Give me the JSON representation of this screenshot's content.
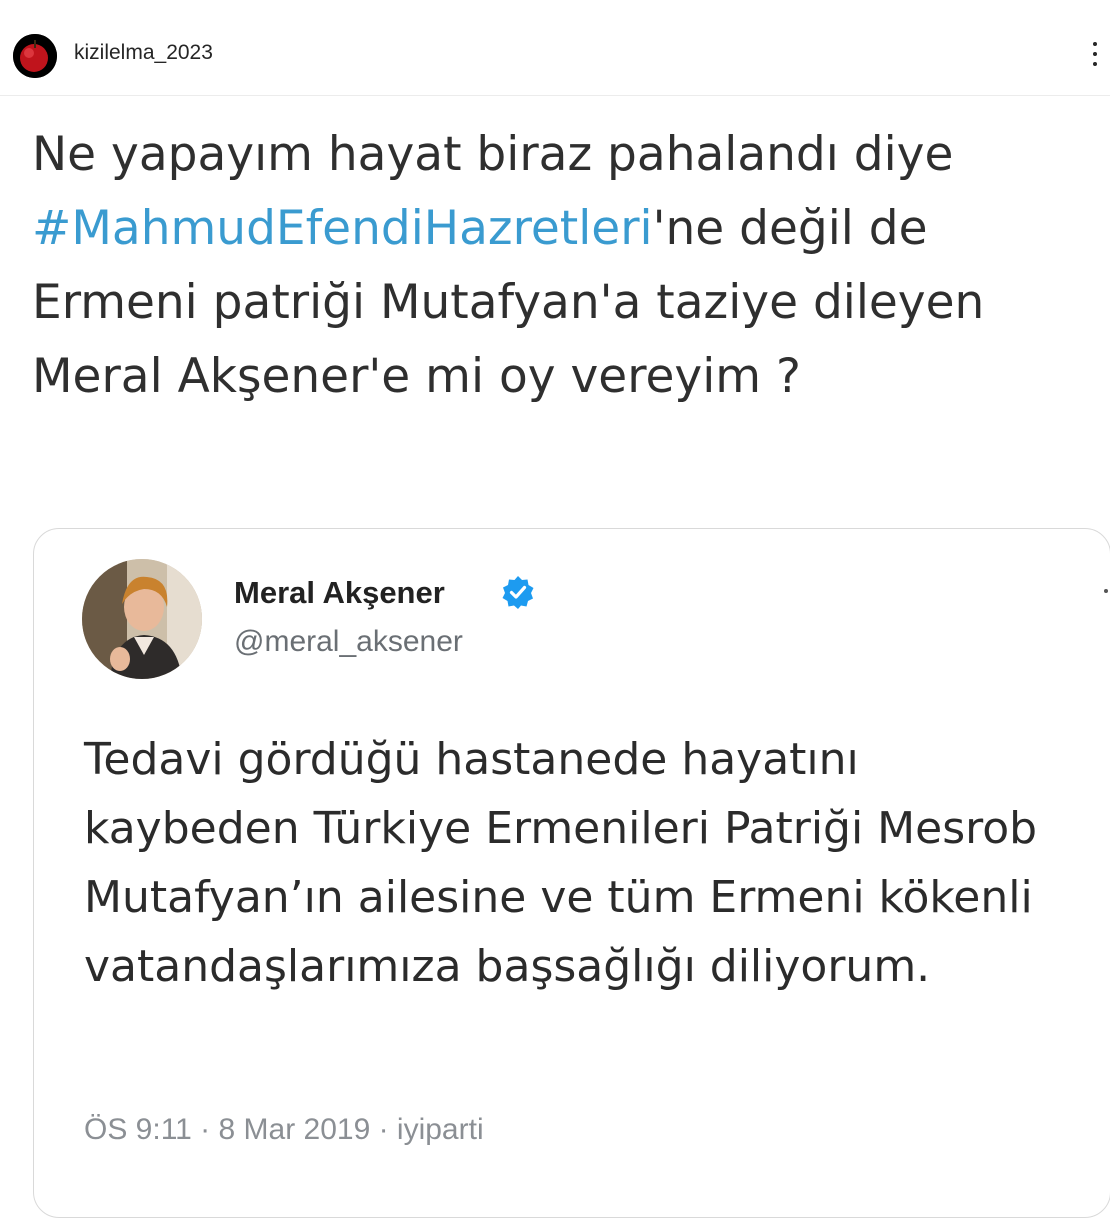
{
  "post": {
    "username": "kizilelma_2023",
    "avatar_icon": "red-apple-icon",
    "more_icon": "more-options-icon"
  },
  "caption": {
    "text_before": "Ne yapayım hayat biraz pahalandı diye ",
    "hashtag": "#MahmudEfendiHazretleri",
    "text_after": "'ne değil de Ermeni patriği Mutafyan'a taziye dileyen Meral Akşener'e mi oy vereyim ?",
    "hashtag_color": "#3a9bd0"
  },
  "quoted_tweet": {
    "name": "Meral Akşener",
    "handle": "@meral_aksener",
    "verified_icon": "verified-badge-icon",
    "verified_color": "#1d9bf0",
    "text": "Tedavi gördüğü hastanede hayatını kaybeden Türkiye Ermenileri Patriği Mesrob Mutafyan’ın ailesine ve tüm Ermeni kökenli vatandaşlarımıza başsağlığı diliyorum.",
    "timestamp": "ÖS 9:11 · 8 Mar 2019 · iyiparti"
  }
}
